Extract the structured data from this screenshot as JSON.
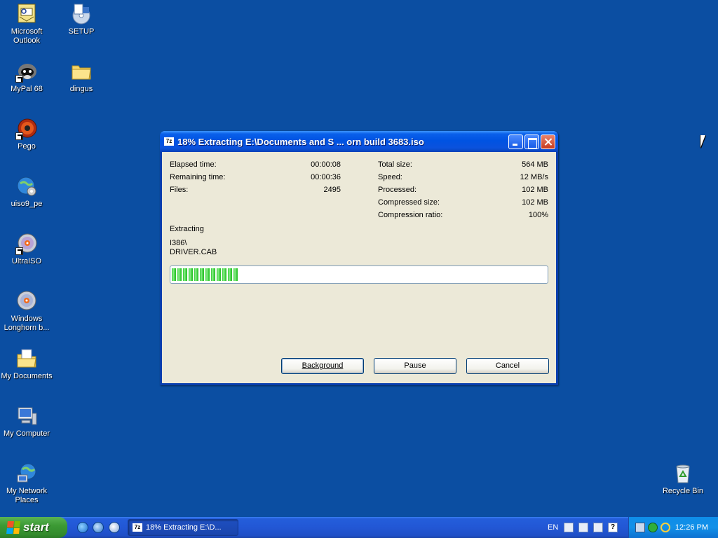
{
  "desktop": {
    "icons": [
      {
        "name": "Microsoft Outlook"
      },
      {
        "name": "SETUP"
      },
      {
        "name": "MyPal 68"
      },
      {
        "name": "dingus"
      },
      {
        "name": "Pego"
      },
      {
        "name": "uiso9_pe"
      },
      {
        "name": "UltraISO"
      },
      {
        "name": "Windows Longhorn b..."
      },
      {
        "name": "My Documents"
      },
      {
        "name": "My Computer"
      },
      {
        "name": "My Network Places"
      },
      {
        "name": "Recycle Bin"
      }
    ]
  },
  "dialog": {
    "app_icon": "7z",
    "title": "18% Extracting E:\\Documents and S ... orn build 3683.iso",
    "progress_fraction": 0.18,
    "left_stats": [
      {
        "label": "Elapsed time:",
        "value": "00:00:08"
      },
      {
        "label": "Remaining time:",
        "value": "00:00:36"
      },
      {
        "label": "Files:",
        "value": "2495"
      }
    ],
    "right_stats": [
      {
        "label": "Total size:",
        "value": "564 MB"
      },
      {
        "label": "Speed:",
        "value": "12 MB/s"
      },
      {
        "label": "Processed:",
        "value": "102 MB"
      },
      {
        "label": "Compressed size:",
        "value": "102 MB"
      },
      {
        "label": "Compression ratio:",
        "value": "100%"
      }
    ],
    "status_label": "Extracting",
    "current_path": "I386\\",
    "current_file": "DRIVER.CAB",
    "buttons": {
      "background": "Background",
      "pause": "Pause",
      "cancel": "Cancel"
    }
  },
  "taskbar": {
    "start_label": "start",
    "task_label": "18% Extracting E:\\D...",
    "language": "EN",
    "clock": "12:26 PM"
  },
  "colors": {
    "desktop": "#0b4ea2",
    "titlebar": "#0053e2",
    "progress": "#2dc52d",
    "start_button": "#3c9a35"
  }
}
